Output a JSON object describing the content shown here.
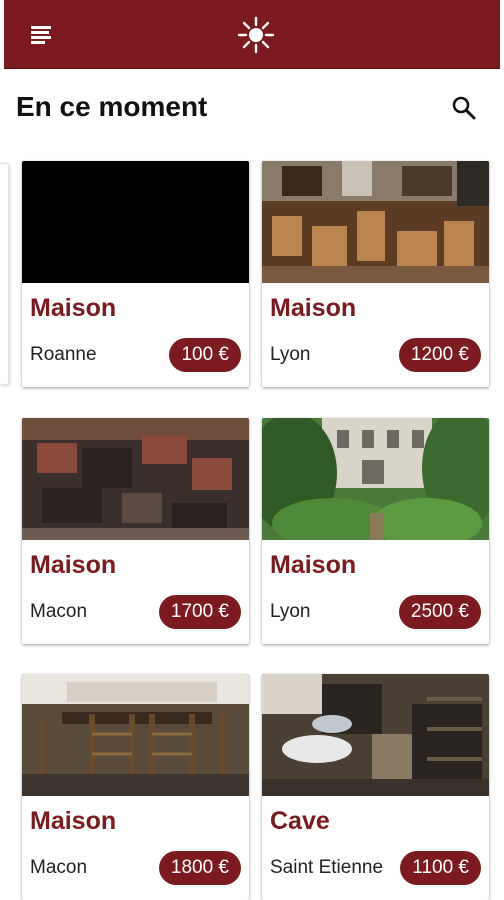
{
  "header": {
    "menu_icon": "hamburger-menu-icon",
    "logo_icon": "sun-logo-icon",
    "bar_color": "#7c1a1f"
  },
  "main": {
    "title": "En ce moment",
    "search_icon": "search-icon",
    "listings": [
      {
        "type": "Maison",
        "city": "Roanne",
        "price": "100 €"
      },
      {
        "type": "Maison",
        "city": "Lyon",
        "price": "1200 €"
      },
      {
        "type": "Maison",
        "city": "Macon",
        "price": "1700 €"
      },
      {
        "type": "Maison",
        "city": "Lyon",
        "price": "2500 €"
      },
      {
        "type": "Maison",
        "city": "Macon",
        "price": "1800 €"
      },
      {
        "type": "Cave",
        "city": "Saint Etienne",
        "price": "1100 €"
      }
    ]
  },
  "colors": {
    "accent": "#7c1a1f",
    "text": "#111111"
  }
}
